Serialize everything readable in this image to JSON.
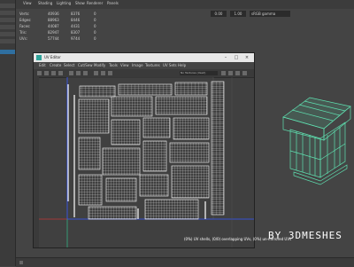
{
  "menu": [
    "View",
    "Shading",
    "Lighting",
    "Show",
    "Renderer",
    "Panels"
  ],
  "hud": {
    "rows": [
      {
        "label": "Verts:",
        "v1": "40936",
        "v2": "8376",
        "v3": "0"
      },
      {
        "label": "Edges:",
        "v1": "88963",
        "v2": "8446",
        "v3": "0"
      },
      {
        "label": "Faces:",
        "v1": "44087",
        "v2": "4431",
        "v3": "0"
      },
      {
        "label": "Tris:",
        "v1": "82947",
        "v2": "8307",
        "v3": "0"
      },
      {
        "label": "UVs:",
        "v1": "57744",
        "v2": "9744",
        "v3": "0"
      }
    ],
    "right_fields": [
      "0.00",
      "1.00",
      "sRGB gamma"
    ]
  },
  "uv_editor": {
    "title": "UV Editor",
    "menu": [
      "Edit",
      "Create",
      "Select",
      "Cut/Sew",
      "Modify",
      "Tools",
      "View",
      "Image",
      "Textures",
      "UV Sets",
      "Help"
    ],
    "toolbar_field": "No Textures (Used)",
    "status": "(0%) UV shells, (0/0) overlapping UVs, (0%) un-mirrored UVs"
  },
  "watermark": "BY 3DMESHES",
  "colors": {
    "accent": "#2fa39a",
    "wire": "#ffffff",
    "model_wire": "#5fe0b0"
  }
}
